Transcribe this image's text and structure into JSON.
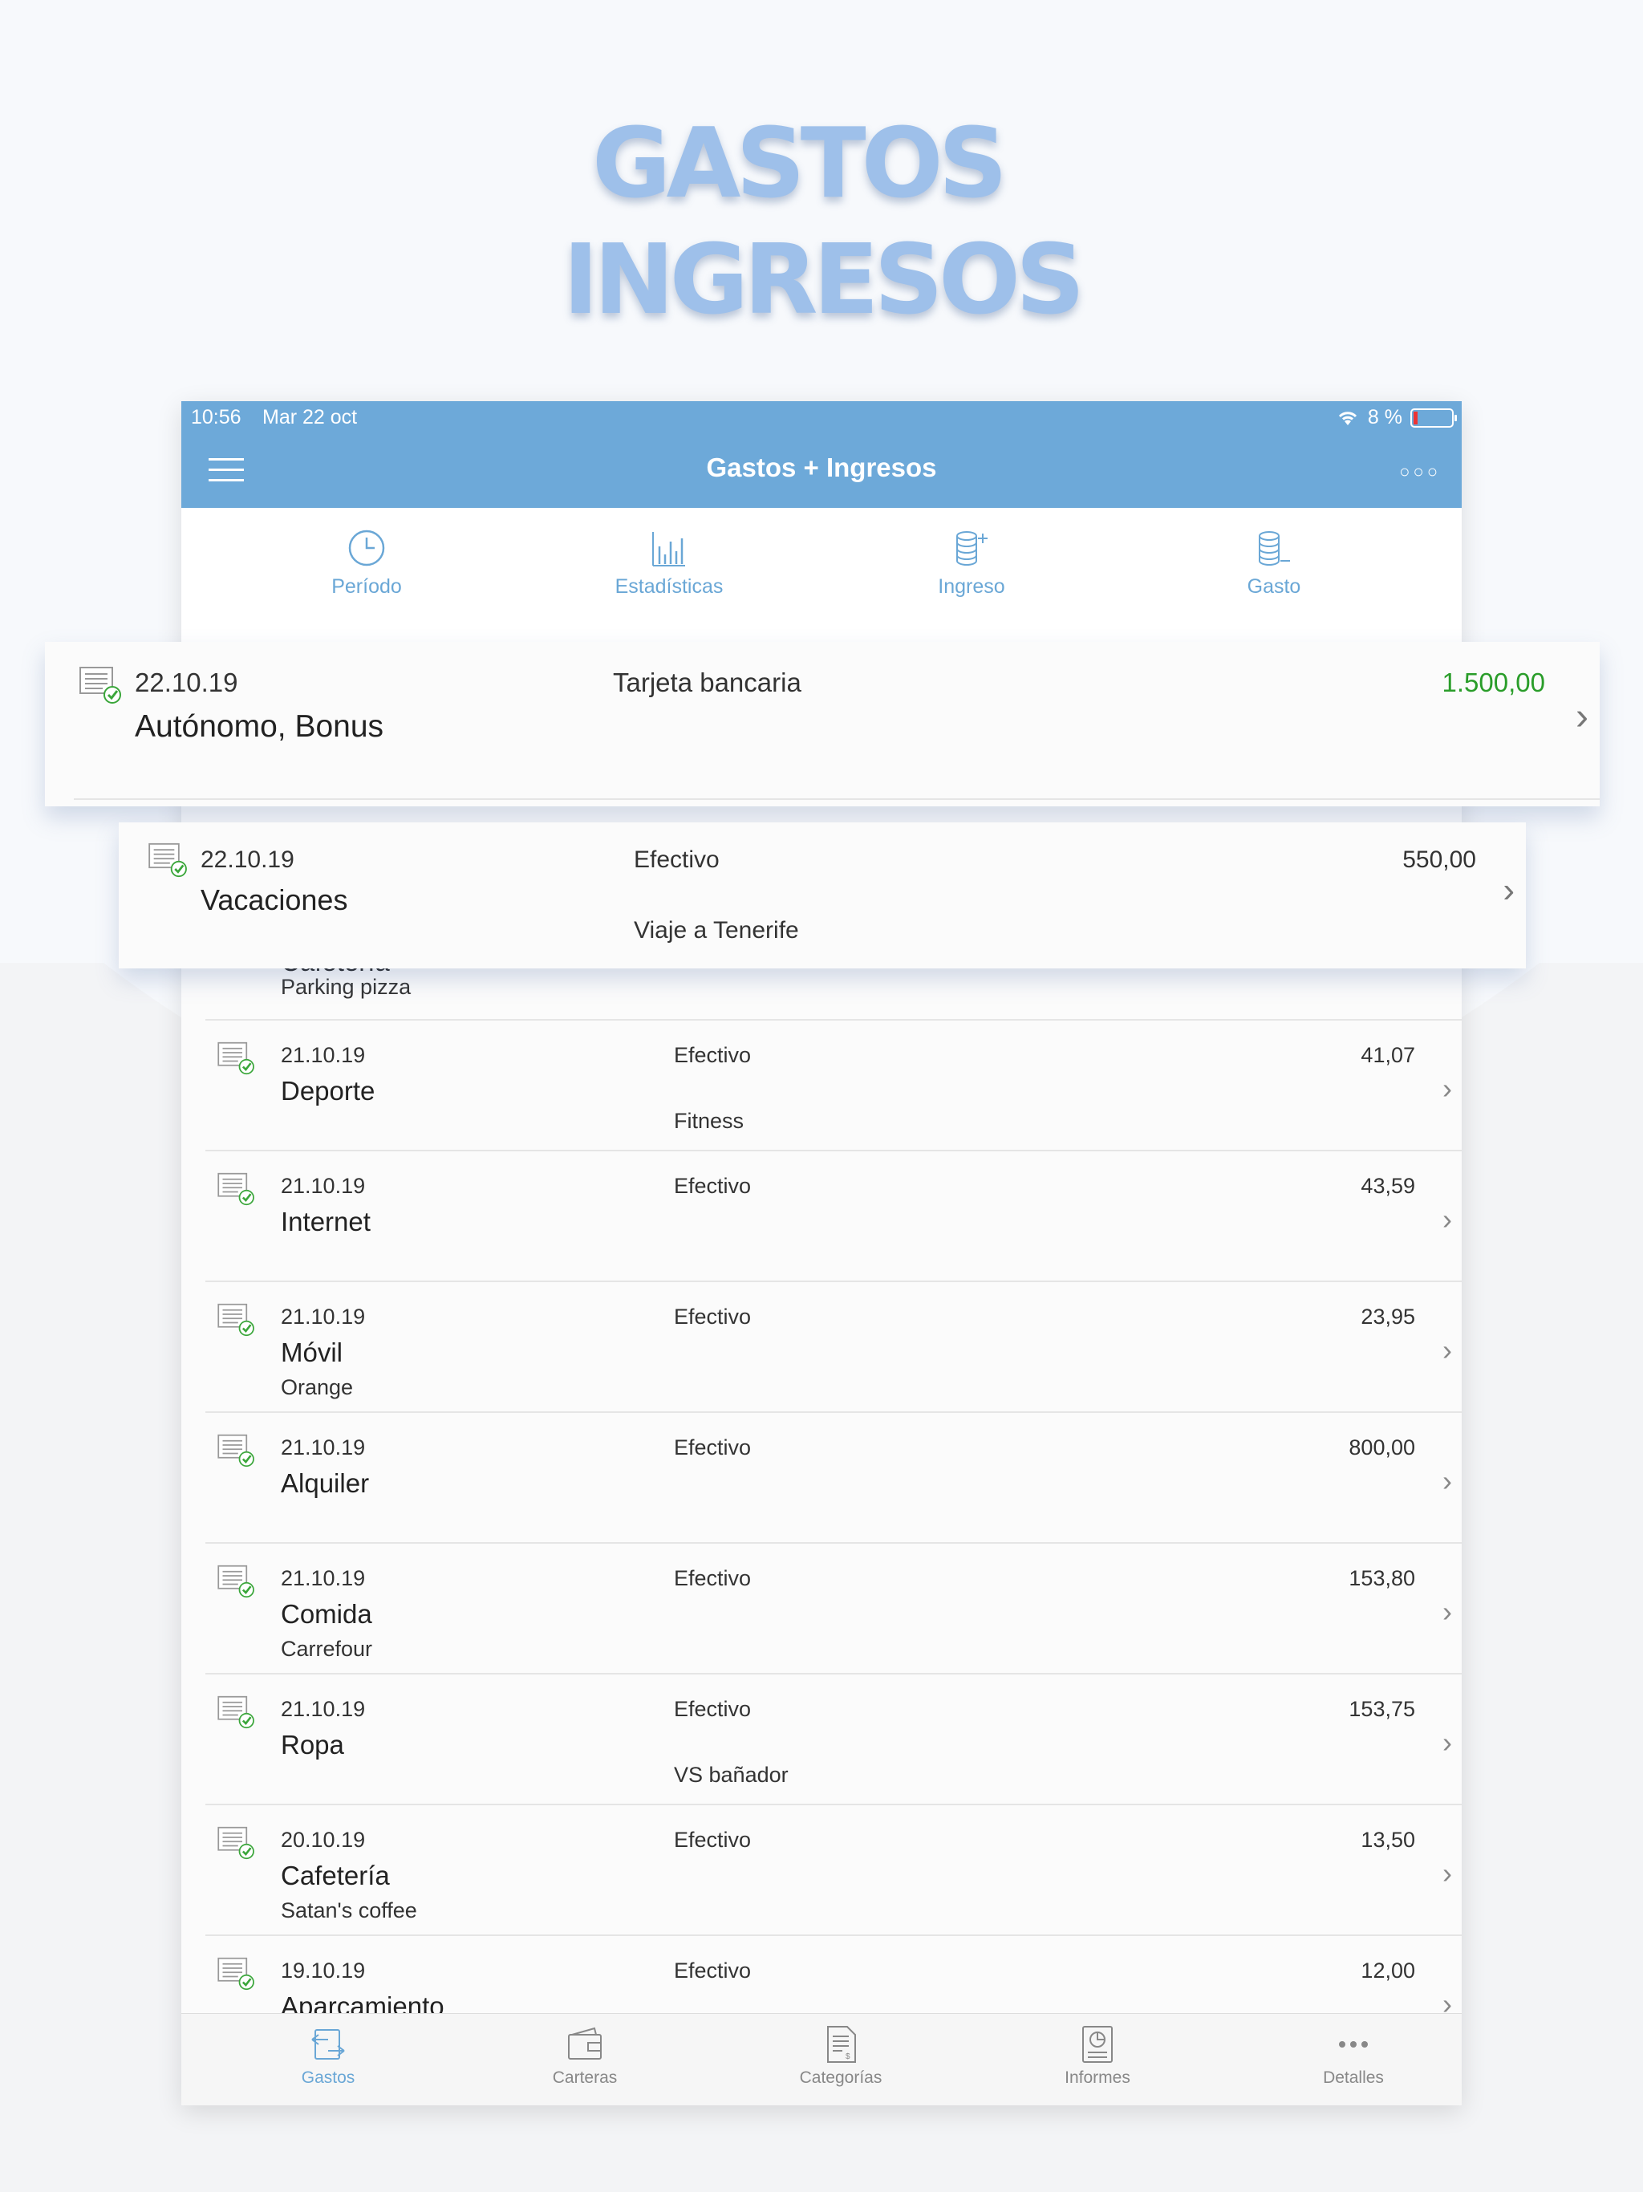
{
  "headline": {
    "line1": "GASTOS",
    "line2": "INGRESOS"
  },
  "status": {
    "time": "10:56",
    "date": "Mar 22 oct",
    "battery": "8 %"
  },
  "app": {
    "title": "Gastos + Ingresos"
  },
  "toolbar": [
    {
      "label": "Período",
      "icon": "clock-icon"
    },
    {
      "label": "Estadísticas",
      "icon": "bar-chart-icon"
    },
    {
      "label": "Ingreso",
      "icon": "coins-plus-icon"
    },
    {
      "label": "Gasto",
      "icon": "coins-minus-icon"
    }
  ],
  "highlight1": {
    "date": "22.10.19",
    "category": "Autónomo, Bonus",
    "account": "Tarjeta bancaria",
    "amount": "1.500,00",
    "amount_color": "#2a9d2a"
  },
  "highlight2": {
    "date": "22.10.19",
    "category": "Vacaciones",
    "account": "Efectivo",
    "amount": "550,00",
    "note": "Viaje a Tenerife"
  },
  "partial_row": {
    "category": "Cafetería",
    "sub": "Parking pizza"
  },
  "rows": [
    {
      "date": "21.10.19",
      "category": "Deporte",
      "account": "Efectivo",
      "amount": "41,07",
      "sub": "",
      "note": "Fitness"
    },
    {
      "date": "21.10.19",
      "category": "Internet",
      "account": "Efectivo",
      "amount": "43,59",
      "sub": "",
      "note": ""
    },
    {
      "date": "21.10.19",
      "category": "Móvil",
      "account": "Efectivo",
      "amount": "23,95",
      "sub": "Orange",
      "note": ""
    },
    {
      "date": "21.10.19",
      "category": "Alquiler",
      "account": "Efectivo",
      "amount": "800,00",
      "sub": "",
      "note": ""
    },
    {
      "date": "21.10.19",
      "category": "Comida",
      "account": "Efectivo",
      "amount": "153,80",
      "sub": "Carrefour",
      "note": ""
    },
    {
      "date": "21.10.19",
      "category": "Ropa",
      "account": "Efectivo",
      "amount": "153,75",
      "sub": "",
      "note": "VS bañador"
    },
    {
      "date": "20.10.19",
      "category": "Cafetería",
      "account": "Efectivo",
      "amount": "13,50",
      "sub": "Satan's coffee",
      "note": ""
    },
    {
      "date": "19.10.19",
      "category": "Aparcamiento",
      "account": "Efectivo",
      "amount": "12,00",
      "sub": "",
      "note": ""
    }
  ],
  "tabs": [
    {
      "label": "Gastos",
      "icon": "transactions-icon",
      "active": true
    },
    {
      "label": "Carteras",
      "icon": "wallet-icon",
      "active": false
    },
    {
      "label": "Categorías",
      "icon": "document-icon",
      "active": false
    },
    {
      "label": "Informes",
      "icon": "report-icon",
      "active": false
    },
    {
      "label": "Detalles",
      "icon": "more-icon",
      "active": false
    }
  ],
  "colors": {
    "accent": "#6da9d9",
    "headline": "#9ec0ea",
    "income": "#2a9d2a"
  }
}
